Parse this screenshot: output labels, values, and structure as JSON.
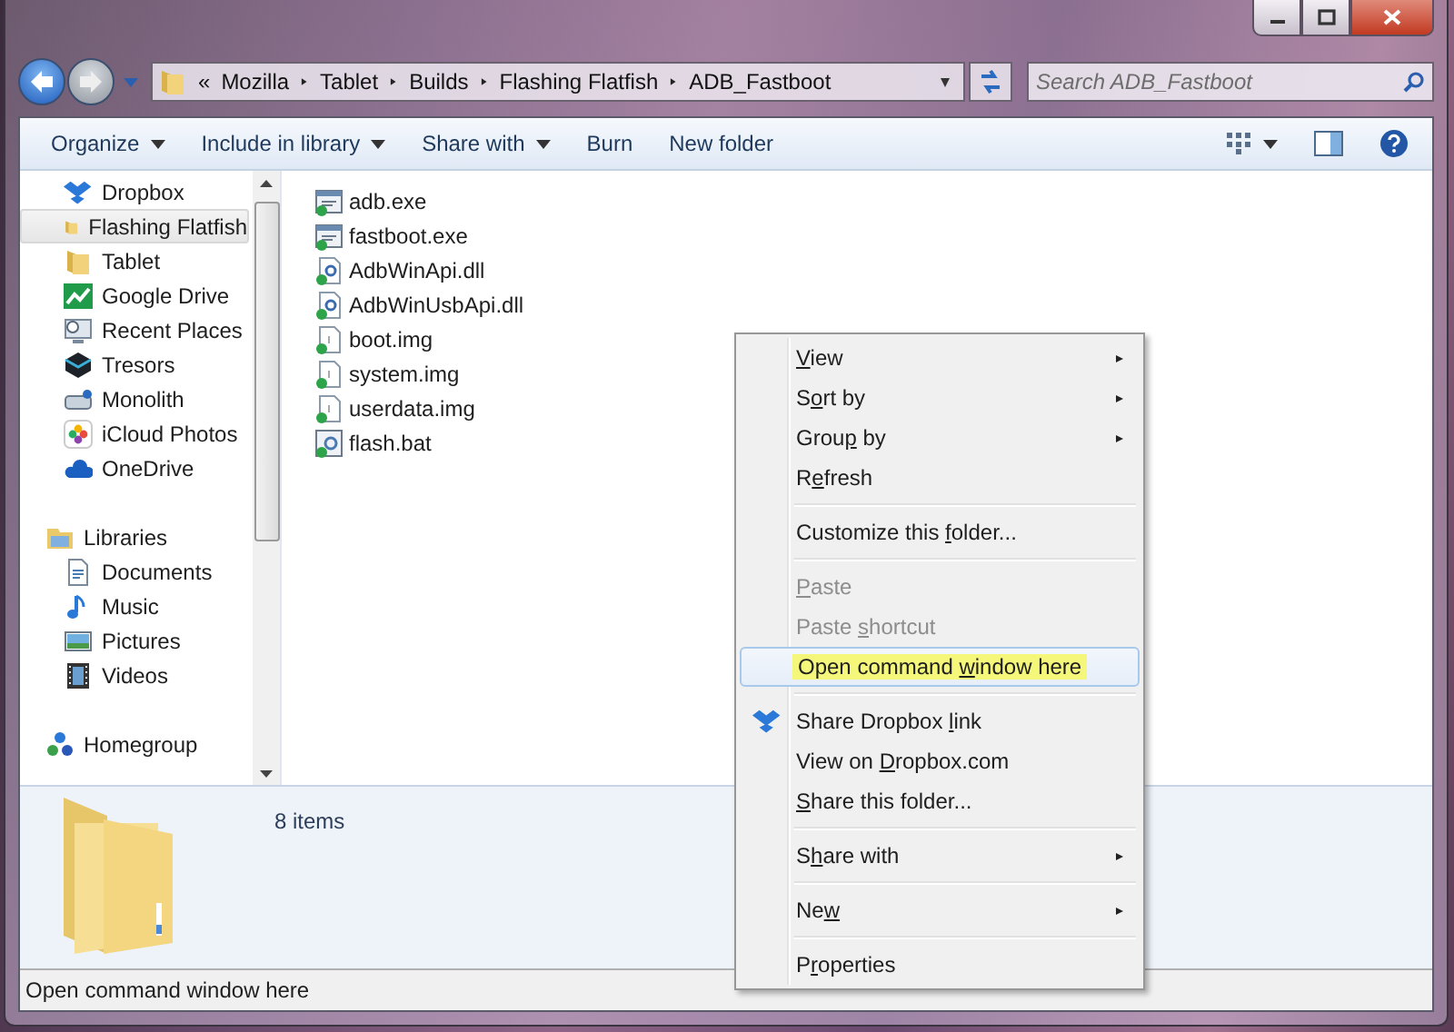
{
  "address": {
    "overflow": "«",
    "segments": [
      "Mozilla",
      "Tablet",
      "Builds",
      "Flashing Flatfish",
      "ADB_Fastboot"
    ]
  },
  "search": {
    "placeholder": "Search ADB_Fastboot"
  },
  "toolbar": [
    {
      "label": "Organize",
      "dropdown": true
    },
    {
      "label": "Include in library",
      "dropdown": true
    },
    {
      "label": "Share with",
      "dropdown": true
    },
    {
      "label": "Burn",
      "dropdown": false
    },
    {
      "label": "New folder",
      "dropdown": false
    }
  ],
  "sidebar": {
    "sections": [
      {
        "items": [
          {
            "label": "Dropbox",
            "selected": false
          },
          {
            "label": "Flashing Flatfish",
            "selected": true
          },
          {
            "label": "Tablet",
            "selected": false
          },
          {
            "label": "Google Drive",
            "selected": false
          },
          {
            "label": "Recent Places",
            "selected": false
          },
          {
            "label": "Tresors",
            "selected": false
          },
          {
            "label": "Monolith",
            "selected": false
          },
          {
            "label": "iCloud Photos",
            "selected": false
          },
          {
            "label": "OneDrive",
            "selected": false
          }
        ]
      },
      {
        "items": [
          {
            "label": "Libraries",
            "selected": false,
            "children": [
              {
                "label": "Documents",
                "selected": false
              },
              {
                "label": "Music",
                "selected": false
              },
              {
                "label": "Pictures",
                "selected": false
              },
              {
                "label": "Videos",
                "selected": false
              }
            ]
          }
        ]
      },
      {
        "items": [
          {
            "label": "Homegroup",
            "selected": false
          }
        ]
      }
    ]
  },
  "files": [
    {
      "name": "adb.exe",
      "kind": "exe"
    },
    {
      "name": "fastboot.exe",
      "kind": "exe"
    },
    {
      "name": "AdbWinApi.dll",
      "kind": "dll"
    },
    {
      "name": "AdbWinUsbApi.dll",
      "kind": "dll"
    },
    {
      "name": "boot.img",
      "kind": "img"
    },
    {
      "name": "system.img",
      "kind": "img"
    },
    {
      "name": "userdata.img",
      "kind": "img"
    },
    {
      "name": "flash.bat",
      "kind": "bat"
    }
  ],
  "details": {
    "count": "8 items"
  },
  "context_menu": {
    "items": [
      {
        "kind": "item",
        "key": "V",
        "after": "iew",
        "submenu": true,
        "disabled": false,
        "selected": false
      },
      {
        "kind": "item",
        "before": "S",
        "key": "o",
        "after": "rt by",
        "submenu": true,
        "disabled": false,
        "selected": false
      },
      {
        "kind": "item",
        "before": "Grou",
        "key": "p",
        "after": " by",
        "submenu": true,
        "disabled": false,
        "selected": false
      },
      {
        "kind": "item",
        "before": "R",
        "key": "e",
        "after": "fresh",
        "submenu": false,
        "disabled": false,
        "selected": false
      },
      {
        "kind": "separator"
      },
      {
        "kind": "item",
        "before": "Customize this ",
        "key": "f",
        "after": "older...",
        "submenu": false,
        "disabled": false,
        "selected": false
      },
      {
        "kind": "separator"
      },
      {
        "kind": "item",
        "key": "P",
        "after": "aste",
        "submenu": false,
        "disabled": true,
        "selected": false
      },
      {
        "kind": "item",
        "before": "Paste ",
        "key": "s",
        "after": "hortcut",
        "submenu": false,
        "disabled": true,
        "selected": false
      },
      {
        "kind": "item",
        "before": "Open command ",
        "key": "w",
        "after": "indow here",
        "submenu": false,
        "disabled": false,
        "selected": true
      },
      {
        "kind": "separator"
      },
      {
        "kind": "item",
        "before": "Share Dropbox ",
        "key": "l",
        "after": "ink",
        "submenu": false,
        "disabled": false,
        "selected": false
      },
      {
        "kind": "item",
        "before": "View on ",
        "key": "D",
        "after": "ropbox.com",
        "submenu": false,
        "disabled": false,
        "selected": false
      },
      {
        "kind": "item",
        "key": "S",
        "after": "hare this folder...",
        "submenu": false,
        "disabled": false,
        "selected": false
      },
      {
        "kind": "separator"
      },
      {
        "kind": "item",
        "before": "S",
        "key": "h",
        "after": "are with",
        "submenu": true,
        "disabled": false,
        "selected": false
      },
      {
        "kind": "separator"
      },
      {
        "kind": "item",
        "before": "Ne",
        "key": "w",
        "submenu": true,
        "disabled": false,
        "selected": false
      },
      {
        "kind": "separator"
      },
      {
        "kind": "item",
        "before": "P",
        "key": "r",
        "after": "operties",
        "submenu": false,
        "disabled": false,
        "selected": false
      }
    ]
  },
  "status_bar": {
    "text": "Open command window here"
  }
}
